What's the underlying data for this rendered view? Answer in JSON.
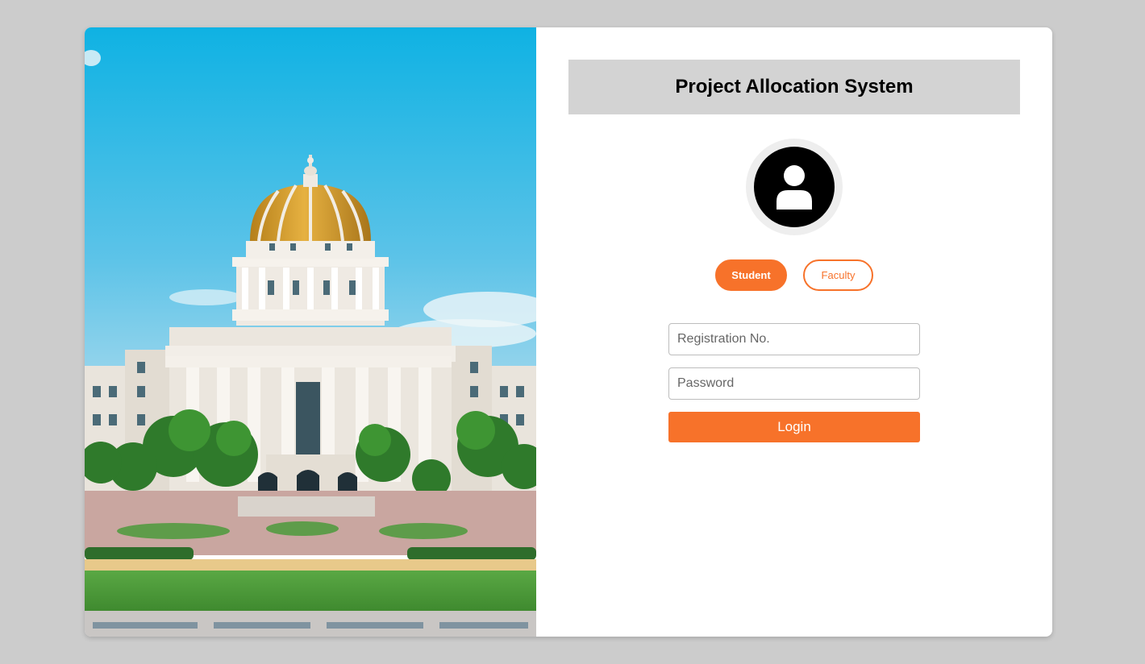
{
  "header": {
    "title": "Project Allocation System"
  },
  "roles": {
    "student_label": "Student",
    "faculty_label": "Faculty",
    "selected": "Student"
  },
  "form": {
    "registration_placeholder": "Registration No.",
    "registration_value": "",
    "password_placeholder": "Password",
    "password_value": "",
    "login_label": "Login"
  },
  "icons": {
    "avatar": "user-avatar-icon",
    "campus_photo": "campus-building-image"
  },
  "colors": {
    "accent": "#f7722a",
    "title_bar": "#d3d3d3",
    "background": "#cccccc",
    "sky_top": "#0fb2e3",
    "sky_bottom": "#86cfe9",
    "dome": "#d8a02d",
    "lawn": "#4d9c3b"
  }
}
